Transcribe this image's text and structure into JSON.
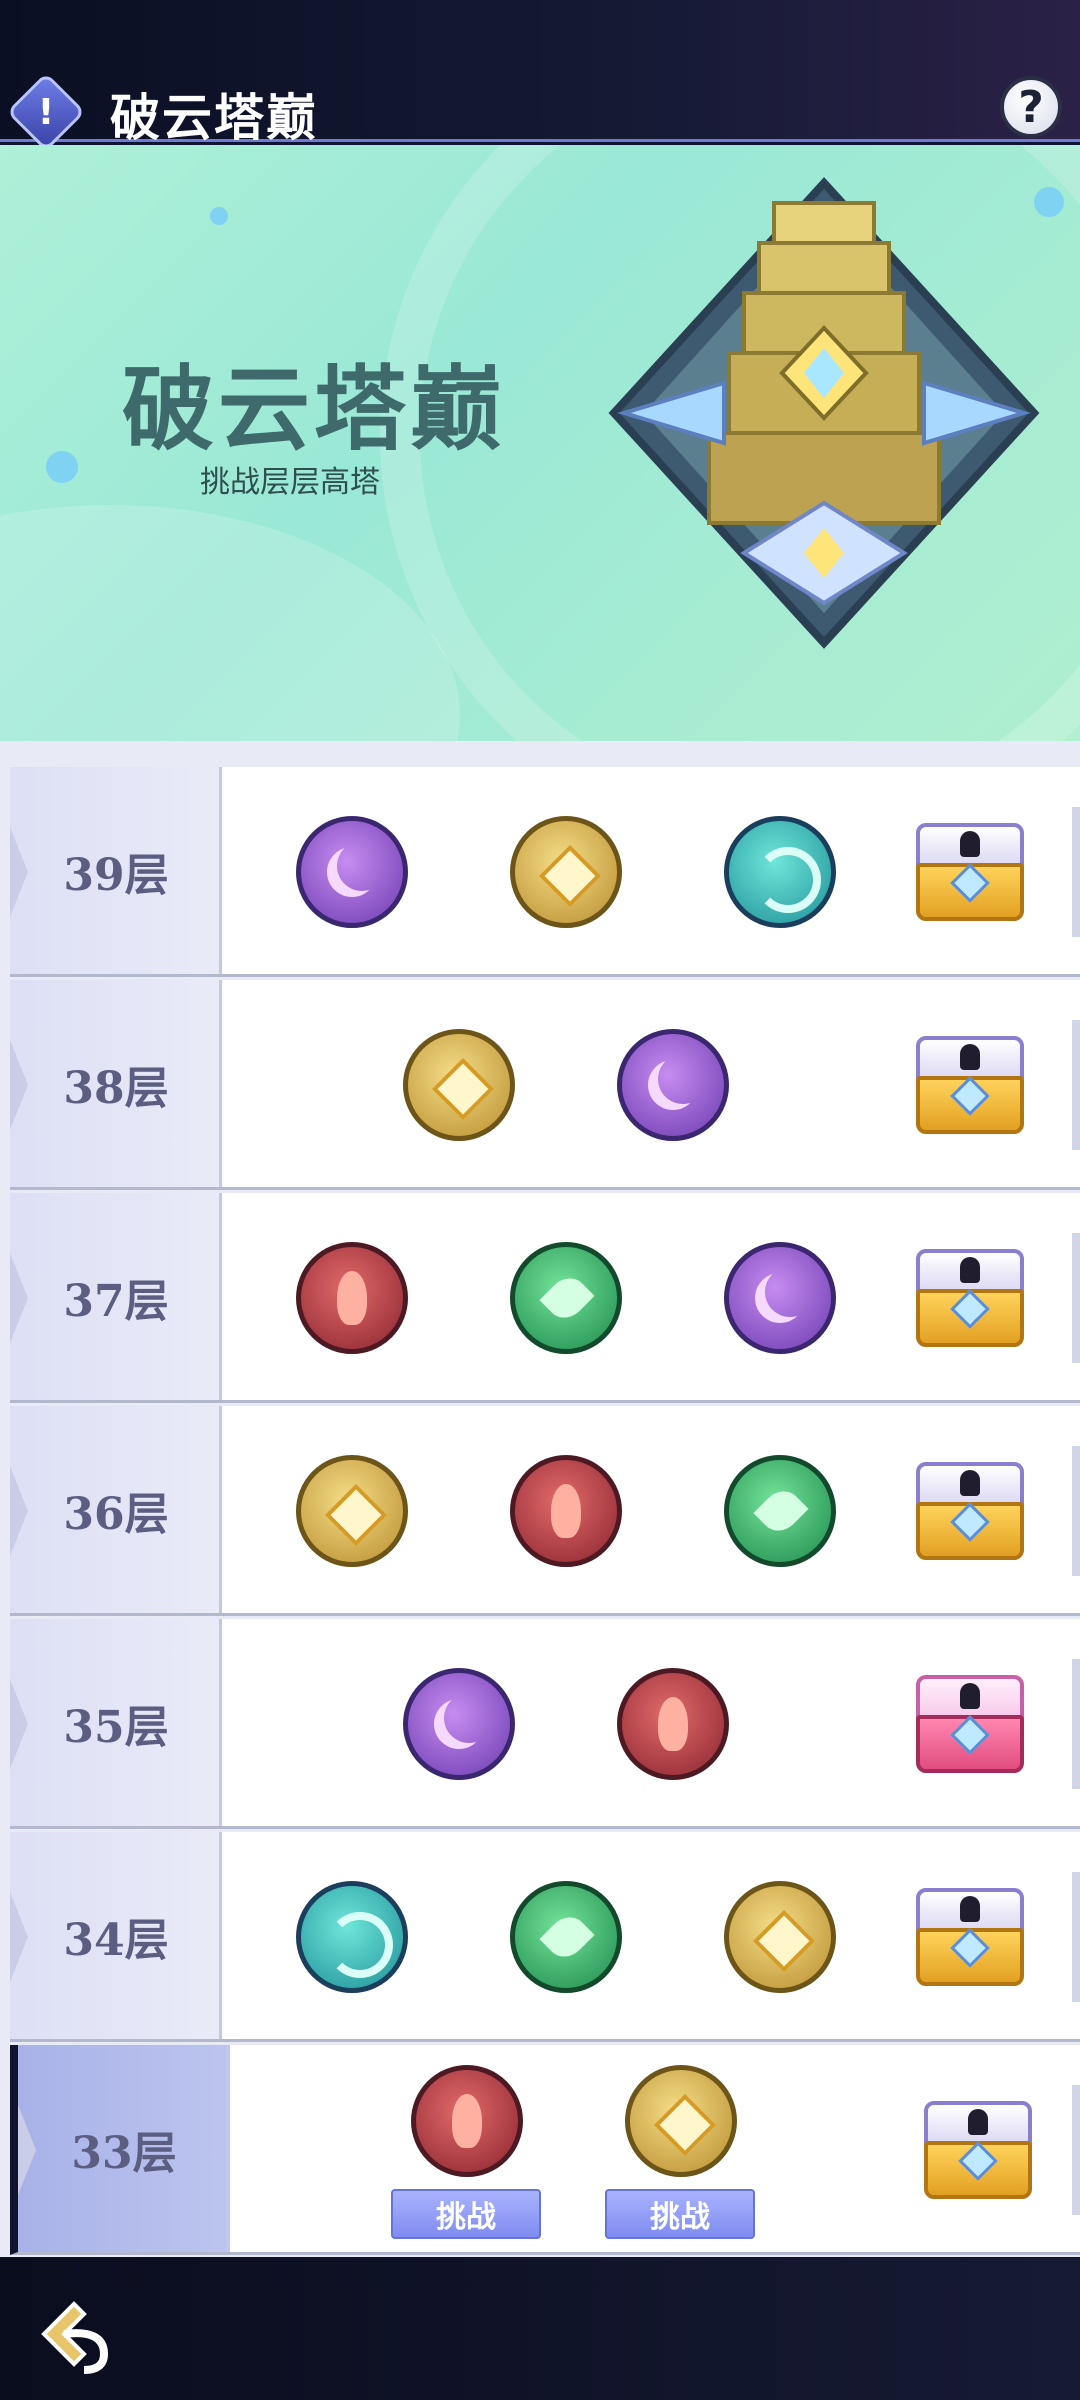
{
  "header": {
    "title": "破云塔巅",
    "info_icon": "exclamation-icon",
    "help_label": "?"
  },
  "banner": {
    "title": "破云塔巅",
    "subtitle": "挑战层层高塔"
  },
  "floors": [
    {
      "label": "39层",
      "elements": [
        "moon",
        "light",
        "wind"
      ],
      "chest": "gold",
      "current": false
    },
    {
      "label": "38层",
      "elements": [
        "light",
        "moon"
      ],
      "chest": "gold",
      "current": false
    },
    {
      "label": "37层",
      "elements": [
        "fire",
        "leaf",
        "moon"
      ],
      "chest": "gold",
      "current": false
    },
    {
      "label": "36层",
      "elements": [
        "light",
        "fire",
        "leaf"
      ],
      "chest": "gold",
      "current": false
    },
    {
      "label": "35层",
      "elements": [
        "moon",
        "fire"
      ],
      "chest": "pink",
      "current": false
    },
    {
      "label": "34层",
      "elements": [
        "wind",
        "leaf",
        "light"
      ],
      "chest": "gold",
      "current": false
    },
    {
      "label": "33层",
      "elements": [
        "fire",
        "light"
      ],
      "chest": "gold",
      "current": true
    }
  ],
  "challenge_label": "挑战",
  "footer": {
    "back_icon": "back-arrow-icon"
  }
}
